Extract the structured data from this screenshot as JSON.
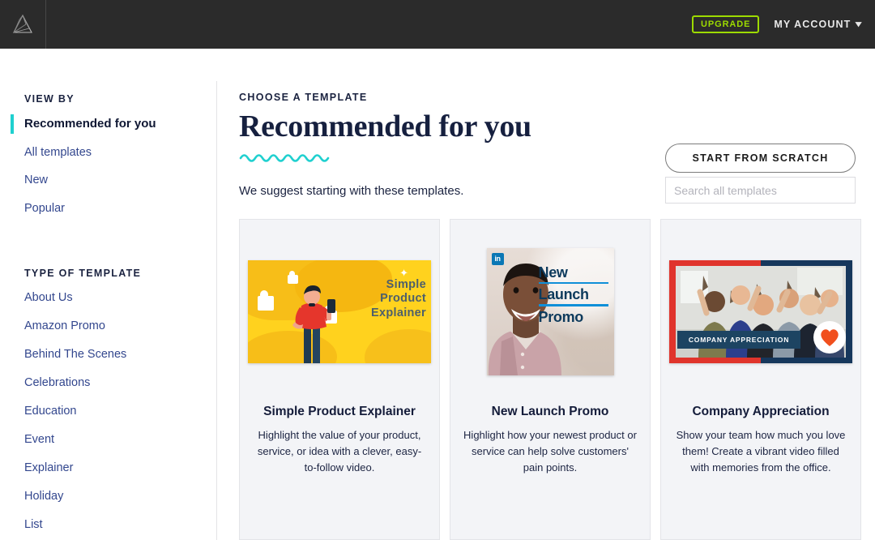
{
  "topbar": {
    "logo_icon": "vidyard-fan-logo",
    "upgrade_label": "UPGRADE",
    "account_label": "MY ACCOUNT",
    "chevron_icon": "chevron-down-icon",
    "bg_color": "#2b2b2b",
    "upgrade_color": "#9ddb00"
  },
  "sidebar": {
    "view_by_heading": "VIEW BY",
    "view_by_items": [
      {
        "label": "Recommended for you",
        "active": true
      },
      {
        "label": "All templates",
        "active": false
      },
      {
        "label": "New",
        "active": false
      },
      {
        "label": "Popular",
        "active": false
      }
    ],
    "type_heading": "TYPE OF TEMPLATE",
    "type_items": [
      {
        "label": "About Us"
      },
      {
        "label": "Amazon Promo"
      },
      {
        "label": "Behind The Scenes"
      },
      {
        "label": "Celebrations"
      },
      {
        "label": "Education"
      },
      {
        "label": "Event"
      },
      {
        "label": "Explainer"
      },
      {
        "label": "Holiday"
      },
      {
        "label": "List"
      }
    ],
    "active_indicator_color": "#1fd0cf",
    "link_color": "#33478e"
  },
  "main": {
    "eyebrow": "CHOOSE A TEMPLATE",
    "title": "Recommended for you",
    "subtitle": "We suggest starting with these templates.",
    "wave_color": "#1fd0cf",
    "start_from_scratch_label": "START FROM SCRATCH",
    "search_placeholder": "Search all templates",
    "search_value": ""
  },
  "cards": [
    {
      "title": "Simple Product Explainer",
      "description": "Highlight the value of your product, service, or idea with a clever, easy-to-follow video.",
      "thumb": {
        "kind": "illustration",
        "bg_color": "#FFD21E",
        "text_color": "#4d5f6b",
        "lines": [
          "Simple",
          "Product",
          "Explainer"
        ]
      }
    },
    {
      "title": "New Launch Promo",
      "description": "Highlight how your newest product or service can help solve customers' pain points.",
      "thumb": {
        "kind": "photo-square",
        "badge": "in",
        "badge_color": "#0a77b5",
        "text_color": "#0d3a5c",
        "rule_color": "#0f8fd8",
        "lines": [
          "New",
          "Launch",
          "Promo"
        ]
      }
    },
    {
      "title": "Company Appreciation",
      "description": "Show your team how much you love them! Create a vibrant video filled with memories from the office.",
      "thumb": {
        "kind": "photo-frame",
        "banner_text": "COMPANY APPRECIATION",
        "frame_left_color": "#e0342c",
        "frame_right_color": "#16375c",
        "heart_color": "#f1501e"
      }
    }
  ]
}
